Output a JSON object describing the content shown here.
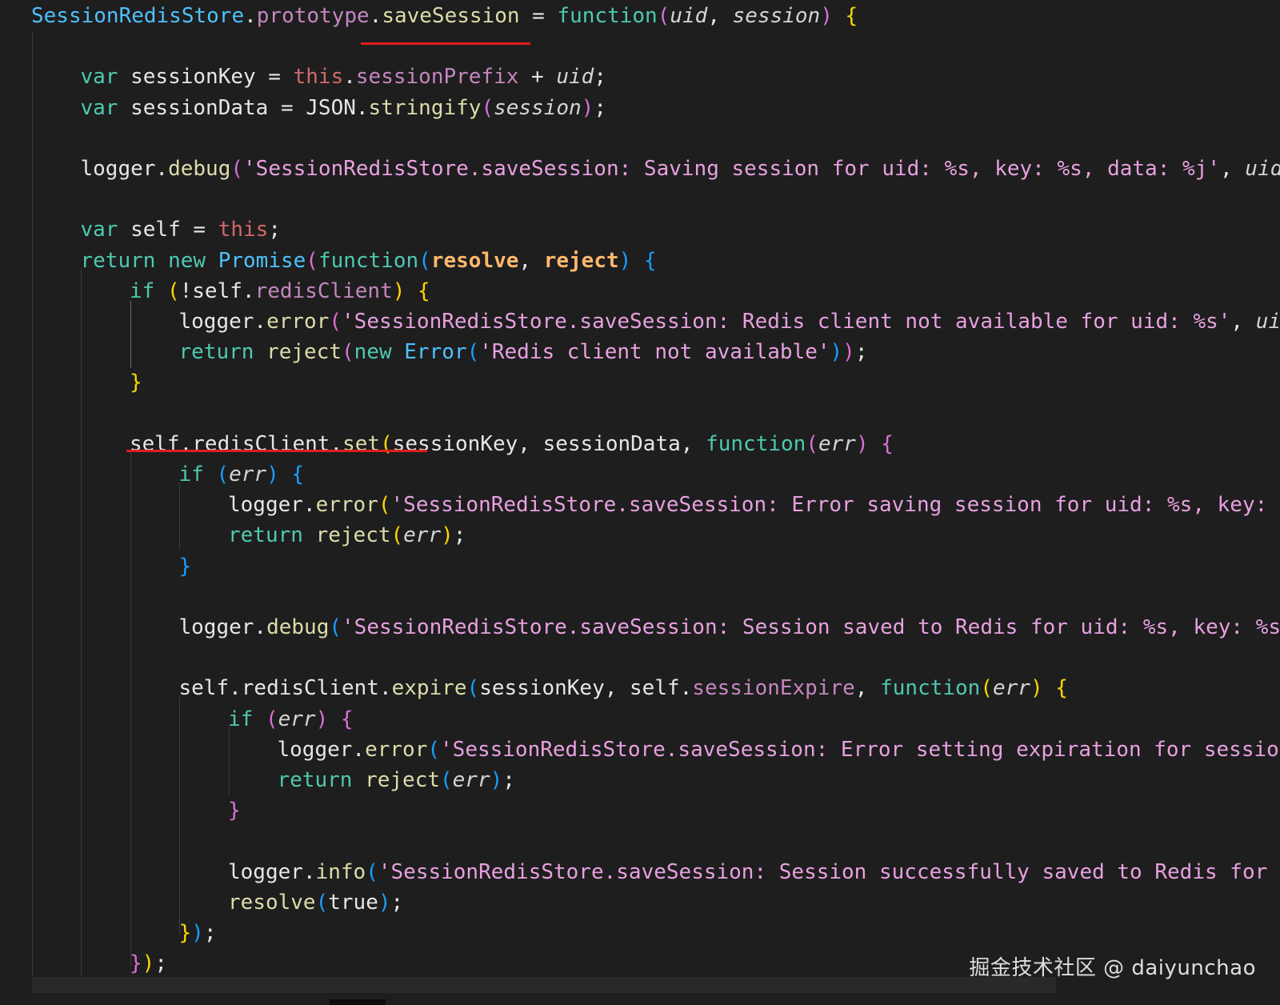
{
  "code": {
    "lines": [
      {
        "indent": 0,
        "tokens": [
          {
            "t": "SessionRedisStore",
            "c": "tok-obj"
          },
          {
            "t": ".",
            "c": "tok-plain"
          },
          {
            "t": "prototype",
            "c": "tok-prop"
          },
          {
            "t": ".",
            "c": "tok-plain"
          },
          {
            "t": "saveSession",
            "c": "tok-fn"
          },
          {
            "t": " = ",
            "c": "tok-plain"
          },
          {
            "t": "function",
            "c": "tok-kw"
          },
          {
            "t": "(",
            "c": "tok-brace-p"
          },
          {
            "t": "uid",
            "c": "tok-it"
          },
          {
            "t": ", ",
            "c": "tok-plain"
          },
          {
            "t": "session",
            "c": "tok-it"
          },
          {
            "t": ")",
            "c": "tok-brace-p"
          },
          {
            "t": " {",
            "c": "tok-brace-y"
          }
        ]
      },
      {
        "indent": 0,
        "tokens": []
      },
      {
        "indent": 1,
        "tokens": [
          {
            "t": "var",
            "c": "tok-kw"
          },
          {
            "t": " sessionKey = ",
            "c": "tok-plain"
          },
          {
            "t": "this",
            "c": "tok-this"
          },
          {
            "t": ".",
            "c": "tok-plain"
          },
          {
            "t": "sessionPrefix",
            "c": "tok-prop"
          },
          {
            "t": " + ",
            "c": "tok-plain"
          },
          {
            "t": "uid",
            "c": "tok-it"
          },
          {
            "t": ";",
            "c": "tok-plain"
          }
        ]
      },
      {
        "indent": 1,
        "tokens": [
          {
            "t": "var",
            "c": "tok-kw"
          },
          {
            "t": " sessionData = JSON.",
            "c": "tok-plain"
          },
          {
            "t": "stringify",
            "c": "tok-fn"
          },
          {
            "t": "(",
            "c": "tok-brace-p"
          },
          {
            "t": "session",
            "c": "tok-it"
          },
          {
            "t": ")",
            "c": "tok-brace-p"
          },
          {
            "t": ";",
            "c": "tok-plain"
          }
        ]
      },
      {
        "indent": 0,
        "tokens": []
      },
      {
        "indent": 1,
        "tokens": [
          {
            "t": "logger.",
            "c": "tok-plain"
          },
          {
            "t": "debug",
            "c": "tok-fn"
          },
          {
            "t": "(",
            "c": "tok-brace-p"
          },
          {
            "t": "'SessionRedisStore.saveSession: Saving session for uid: %s, key: %s, data: %j'",
            "c": "tok-str"
          },
          {
            "t": ", ",
            "c": "tok-plain"
          },
          {
            "t": "uid",
            "c": "tok-it"
          }
        ]
      },
      {
        "indent": 0,
        "tokens": []
      },
      {
        "indent": 1,
        "tokens": [
          {
            "t": "var",
            "c": "tok-kw"
          },
          {
            "t": " self = ",
            "c": "tok-plain"
          },
          {
            "t": "this",
            "c": "tok-this"
          },
          {
            "t": ";",
            "c": "tok-plain"
          }
        ]
      },
      {
        "indent": 1,
        "tokens": [
          {
            "t": "return",
            "c": "tok-kw"
          },
          {
            "t": " ",
            "c": "tok-plain"
          },
          {
            "t": "new",
            "c": "tok-kw"
          },
          {
            "t": " ",
            "c": "tok-plain"
          },
          {
            "t": "Promise",
            "c": "tok-obj"
          },
          {
            "t": "(",
            "c": "tok-brace-p"
          },
          {
            "t": "function",
            "c": "tok-kw"
          },
          {
            "t": "(",
            "c": "tok-brace-b"
          },
          {
            "t": "resolve",
            "c": "tok-bold"
          },
          {
            "t": ", ",
            "c": "tok-plain"
          },
          {
            "t": "reject",
            "c": "tok-bold"
          },
          {
            "t": ")",
            "c": "tok-brace-b"
          },
          {
            "t": " {",
            "c": "tok-brace-b"
          }
        ]
      },
      {
        "indent": 2,
        "tokens": [
          {
            "t": "if",
            "c": "tok-kw"
          },
          {
            "t": " ",
            "c": "tok-plain"
          },
          {
            "t": "(",
            "c": "tok-brace-y"
          },
          {
            "t": "!self.",
            "c": "tok-plain"
          },
          {
            "t": "redisClient",
            "c": "tok-prop"
          },
          {
            "t": ")",
            "c": "tok-brace-y"
          },
          {
            "t": " {",
            "c": "tok-brace-y"
          }
        ]
      },
      {
        "indent": 3,
        "tokens": [
          {
            "t": "logger.",
            "c": "tok-plain"
          },
          {
            "t": "error",
            "c": "tok-fn"
          },
          {
            "t": "(",
            "c": "tok-brace-p"
          },
          {
            "t": "'SessionRedisStore.saveSession: Redis client not available for uid: %s'",
            "c": "tok-str"
          },
          {
            "t": ", ",
            "c": "tok-plain"
          },
          {
            "t": "ui",
            "c": "tok-it"
          }
        ]
      },
      {
        "indent": 3,
        "tokens": [
          {
            "t": "return",
            "c": "tok-kw"
          },
          {
            "t": " ",
            "c": "tok-plain"
          },
          {
            "t": "reject",
            "c": "tok-fn"
          },
          {
            "t": "(",
            "c": "tok-brace-p"
          },
          {
            "t": "new",
            "c": "tok-kw"
          },
          {
            "t": " ",
            "c": "tok-plain"
          },
          {
            "t": "Error",
            "c": "tok-obj"
          },
          {
            "t": "(",
            "c": "tok-brace-b"
          },
          {
            "t": "'Redis client not available'",
            "c": "tok-str"
          },
          {
            "t": ")",
            "c": "tok-brace-b"
          },
          {
            "t": ")",
            "c": "tok-brace-p"
          },
          {
            "t": ";",
            "c": "tok-plain"
          }
        ]
      },
      {
        "indent": 2,
        "tokens": [
          {
            "t": "}",
            "c": "tok-brace-y"
          }
        ]
      },
      {
        "indent": 0,
        "tokens": []
      },
      {
        "indent": 2,
        "tokens": [
          {
            "t": "self.redisClient.",
            "c": "tok-plain"
          },
          {
            "t": "set",
            "c": "tok-fn"
          },
          {
            "t": "(",
            "c": "tok-brace-y"
          },
          {
            "t": "sessionKey, sessionData, ",
            "c": "tok-plain"
          },
          {
            "t": "function",
            "c": "tok-kw"
          },
          {
            "t": "(",
            "c": "tok-brace-p"
          },
          {
            "t": "err",
            "c": "tok-it"
          },
          {
            "t": ")",
            "c": "tok-brace-p"
          },
          {
            "t": " {",
            "c": "tok-brace-p"
          }
        ]
      },
      {
        "indent": 3,
        "tokens": [
          {
            "t": "if",
            "c": "tok-kw"
          },
          {
            "t": " ",
            "c": "tok-plain"
          },
          {
            "t": "(",
            "c": "tok-brace-b"
          },
          {
            "t": "err",
            "c": "tok-it"
          },
          {
            "t": ")",
            "c": "tok-brace-b"
          },
          {
            "t": " {",
            "c": "tok-brace-b"
          }
        ]
      },
      {
        "indent": 4,
        "tokens": [
          {
            "t": "logger.",
            "c": "tok-plain"
          },
          {
            "t": "error",
            "c": "tok-fn"
          },
          {
            "t": "(",
            "c": "tok-brace-y"
          },
          {
            "t": "'SessionRedisStore.saveSession: Error saving session for uid: %s, key: ",
            "c": "tok-str"
          }
        ]
      },
      {
        "indent": 4,
        "tokens": [
          {
            "t": "return",
            "c": "tok-kw"
          },
          {
            "t": " ",
            "c": "tok-plain"
          },
          {
            "t": "reject",
            "c": "tok-fn"
          },
          {
            "t": "(",
            "c": "tok-brace-y"
          },
          {
            "t": "err",
            "c": "tok-it"
          },
          {
            "t": ")",
            "c": "tok-brace-y"
          },
          {
            "t": ";",
            "c": "tok-plain"
          }
        ]
      },
      {
        "indent": 3,
        "tokens": [
          {
            "t": "}",
            "c": "tok-brace-b"
          }
        ]
      },
      {
        "indent": 0,
        "tokens": []
      },
      {
        "indent": 3,
        "tokens": [
          {
            "t": "logger.",
            "c": "tok-plain"
          },
          {
            "t": "debug",
            "c": "tok-fn"
          },
          {
            "t": "(",
            "c": "tok-brace-b"
          },
          {
            "t": "'SessionRedisStore.saveSession: Session saved to Redis for uid: %s, key: %s",
            "c": "tok-str"
          }
        ]
      },
      {
        "indent": 0,
        "tokens": []
      },
      {
        "indent": 3,
        "tokens": [
          {
            "t": "self.redisClient.",
            "c": "tok-plain"
          },
          {
            "t": "expire",
            "c": "tok-fn"
          },
          {
            "t": "(",
            "c": "tok-brace-b"
          },
          {
            "t": "sessionKey, self.",
            "c": "tok-plain"
          },
          {
            "t": "sessionExpire",
            "c": "tok-prop"
          },
          {
            "t": ", ",
            "c": "tok-plain"
          },
          {
            "t": "function",
            "c": "tok-kw"
          },
          {
            "t": "(",
            "c": "tok-brace-y"
          },
          {
            "t": "err",
            "c": "tok-it"
          },
          {
            "t": ")",
            "c": "tok-brace-y"
          },
          {
            "t": " {",
            "c": "tok-brace-y"
          }
        ]
      },
      {
        "indent": 4,
        "tokens": [
          {
            "t": "if",
            "c": "tok-kw"
          },
          {
            "t": " ",
            "c": "tok-plain"
          },
          {
            "t": "(",
            "c": "tok-brace-p"
          },
          {
            "t": "err",
            "c": "tok-it"
          },
          {
            "t": ")",
            "c": "tok-brace-p"
          },
          {
            "t": " {",
            "c": "tok-brace-p"
          }
        ]
      },
      {
        "indent": 5,
        "tokens": [
          {
            "t": "logger.",
            "c": "tok-plain"
          },
          {
            "t": "error",
            "c": "tok-fn"
          },
          {
            "t": "(",
            "c": "tok-brace-b"
          },
          {
            "t": "'SessionRedisStore.saveSession: Error setting expiration for sessio",
            "c": "tok-str"
          }
        ]
      },
      {
        "indent": 5,
        "tokens": [
          {
            "t": "return",
            "c": "tok-kw"
          },
          {
            "t": " ",
            "c": "tok-plain"
          },
          {
            "t": "reject",
            "c": "tok-fn"
          },
          {
            "t": "(",
            "c": "tok-brace-b"
          },
          {
            "t": "err",
            "c": "tok-it"
          },
          {
            "t": ")",
            "c": "tok-brace-b"
          },
          {
            "t": ";",
            "c": "tok-plain"
          }
        ]
      },
      {
        "indent": 4,
        "tokens": [
          {
            "t": "}",
            "c": "tok-brace-p"
          }
        ]
      },
      {
        "indent": 0,
        "tokens": []
      },
      {
        "indent": 4,
        "tokens": [
          {
            "t": "logger.",
            "c": "tok-plain"
          },
          {
            "t": "info",
            "c": "tok-fn"
          },
          {
            "t": "(",
            "c": "tok-brace-b"
          },
          {
            "t": "'SessionRedisStore.saveSession: Session successfully saved to Redis for",
            "c": "tok-str"
          }
        ]
      },
      {
        "indent": 4,
        "tokens": [
          {
            "t": "resolve",
            "c": "tok-fn"
          },
          {
            "t": "(",
            "c": "tok-brace-b"
          },
          {
            "t": "true",
            "c": "tok-plain"
          },
          {
            "t": ")",
            "c": "tok-brace-b"
          },
          {
            "t": ";",
            "c": "tok-plain"
          }
        ]
      },
      {
        "indent": 3,
        "tokens": [
          {
            "t": "}",
            "c": "tok-brace-y"
          },
          {
            "t": ")",
            "c": "tok-brace-b"
          },
          {
            "t": ";",
            "c": "tok-plain"
          }
        ]
      },
      {
        "indent": 2,
        "tokens": [
          {
            "t": "}",
            "c": "tok-brace-p"
          },
          {
            "t": ")",
            "c": "tok-brace-y"
          },
          {
            "t": ";",
            "c": "tok-plain"
          }
        ]
      }
    ]
  },
  "watermark": {
    "text": "掘金技术社区 @ daiyunchao"
  },
  "colors": {
    "background": "#1e1e1e",
    "highlight_underline": "#e11d1d"
  }
}
